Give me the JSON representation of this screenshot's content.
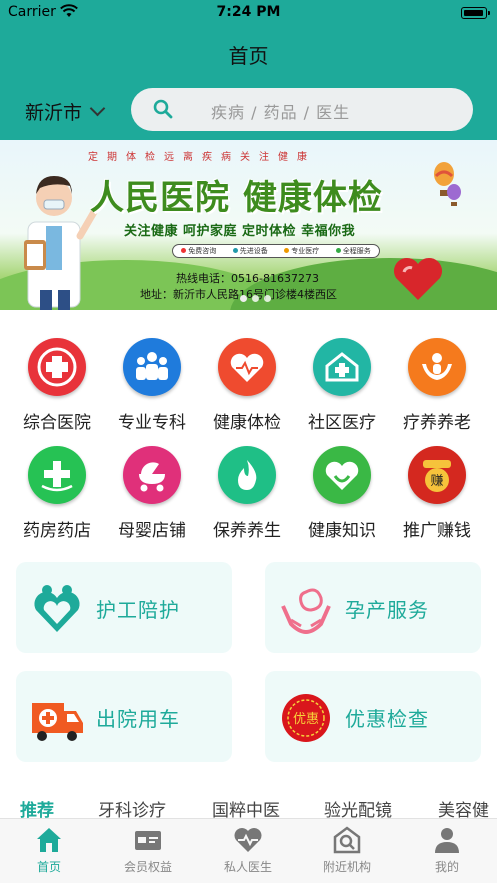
{
  "status_bar": {
    "carrier": "Carrier",
    "time": "7:24 PM"
  },
  "header": {
    "title": "首页",
    "city": "新沂市",
    "search_placeholder": "疾病 / 药品 / 医生"
  },
  "banner": {
    "top_line": "定期体检远离疾病关注健康",
    "title": "人民医院  健康体检",
    "slogan": "关注健康 呵护家庭 定时体检 幸福你我",
    "pills": [
      "免费咨询",
      "先进设备",
      "专业医疗",
      "全程服务"
    ],
    "hotline": "热线电话：0516-81637273",
    "address": "地址：新沂市人民路16号门诊楼4楼西区"
  },
  "categories": [
    {
      "label": "综合医院",
      "icon": "hospital-cross-icon",
      "color": "#e8333a"
    },
    {
      "label": "专业专科",
      "icon": "doctors-group-icon",
      "color": "#1f7bdc"
    },
    {
      "label": "健康体检",
      "icon": "heart-check-icon",
      "color": "#ef4b2f"
    },
    {
      "label": "社区医疗",
      "icon": "community-clinic-icon",
      "color": "#22b6a4"
    },
    {
      "label": "疗养养老",
      "icon": "elderly-care-icon",
      "color": "#f57a1d"
    },
    {
      "label": "药房药店",
      "icon": "pharmacy-cross-icon",
      "color": "#26c254"
    },
    {
      "label": "母婴店铺",
      "icon": "baby-stroller-icon",
      "color": "#e0307a"
    },
    {
      "label": "保养养生",
      "icon": "flame-icon",
      "color": "#1fbf86"
    },
    {
      "label": "健康知识",
      "icon": "heart-knowledge-icon",
      "color": "#3ab845"
    },
    {
      "label": "推广赚钱",
      "icon": "money-bag-icon",
      "color": "#d4281f"
    }
  ],
  "service_cards": [
    {
      "label": "护工陪护",
      "icon": "caregiver-heart-icon"
    },
    {
      "label": "孕产服务",
      "icon": "maternity-hands-icon"
    },
    {
      "label": "出院用车",
      "icon": "ambulance-icon"
    },
    {
      "label": "优惠检查",
      "icon": "discount-badge-icon",
      "badge_text": "优惠"
    }
  ],
  "tabs": [
    "推荐",
    "牙科诊疗",
    "国粹中医",
    "验光配镜",
    "美容健"
  ],
  "tab_bar": [
    {
      "label": "首页",
      "icon": "home-icon"
    },
    {
      "label": "会员权益",
      "icon": "member-card-icon"
    },
    {
      "label": "私人医生",
      "icon": "heartbeat-icon"
    },
    {
      "label": "附近机构",
      "icon": "nearby-building-icon"
    },
    {
      "label": "我的",
      "icon": "user-icon"
    }
  ],
  "colors": {
    "accent": "#1eaa9a",
    "card_bg": "#eefaf9"
  }
}
